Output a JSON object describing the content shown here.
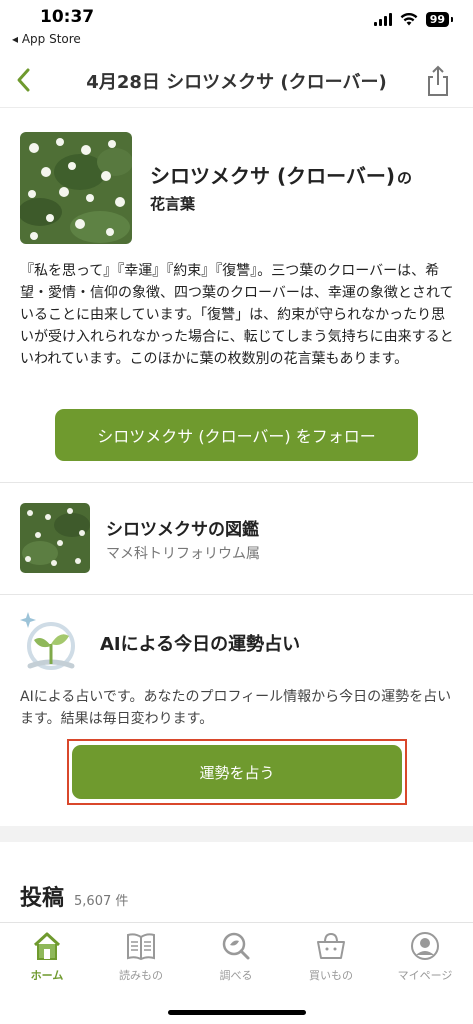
{
  "status": {
    "time": "10:37",
    "back_app": "App Store",
    "battery": "99"
  },
  "nav": {
    "title": "4月28日 シロツメクサ (クローバー)",
    "back_icon": "chevron-left-icon",
    "share_icon": "share-icon"
  },
  "flower": {
    "name": "シロツメクサ (クローバー)",
    "name_suffix": "の",
    "subtitle": "花言葉",
    "description": "『私を思って』『幸運』『約束』『復讐』。三つ葉のクローバーは、希望・愛情・信仰の象徴、四つ葉のクローバーは、幸運の象徴とされていることに由来しています。「復讐」は、約束が守られなかったり思いが受け入れられなかった場合に、転じてしまう気持ちに由来するといわれています。このほかに葉の枚数別の花言葉もあります。",
    "follow_label": "シロツメクサ (クローバー) をフォロー"
  },
  "encyclopedia": {
    "title": "シロツメクサの図鑑",
    "subtitle": "マメ科トリフォリウム属"
  },
  "ai_fortune": {
    "title": "AIによる今日の運勢占い",
    "description": "AIによる占いです。あなたのプロフィール情報から今日の運勢を占います。結果は毎日変わります。",
    "button_label": "運勢を占う"
  },
  "posts": {
    "title": "投稿",
    "count": "5,607 件"
  },
  "tabs": [
    {
      "label": "ホーム",
      "icon": "home-icon",
      "active": true
    },
    {
      "label": "読みもの",
      "icon": "book-icon",
      "active": false
    },
    {
      "label": "調べる",
      "icon": "search-leaf-icon",
      "active": false
    },
    {
      "label": "買いもの",
      "icon": "shopping-basket-icon",
      "active": false
    },
    {
      "label": "マイページ",
      "icon": "person-icon",
      "active": false
    }
  ],
  "colors": {
    "accent": "#6f9a2e",
    "highlight_outline": "#d9472b"
  }
}
